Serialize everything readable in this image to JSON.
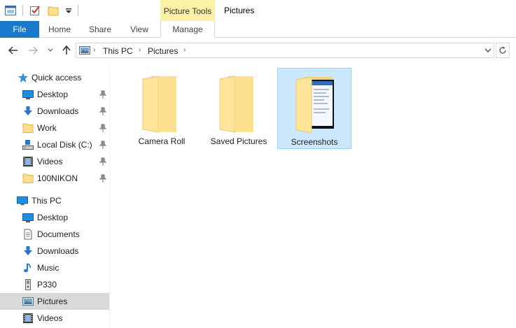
{
  "window": {
    "title": "Pictures"
  },
  "quick_access_toolbar": {
    "icons": [
      "properties-icon",
      "checkmark-icon",
      "new-folder-icon",
      "customize-dropdown-icon"
    ]
  },
  "ribbon": {
    "contextual_group": "Picture Tools",
    "tabs": [
      "File",
      "Home",
      "Share",
      "View",
      "Manage"
    ],
    "colors": {
      "file_tab": "#1979ca",
      "contextual": "#fbf2a8"
    }
  },
  "address_bar": {
    "crumbs": [
      "This PC",
      "Pictures"
    ],
    "icon": "pictures-library-icon"
  },
  "sidebar": {
    "quick_access": {
      "label": "Quick access",
      "items": [
        {
          "label": "Desktop",
          "icon": "desktop-icon",
          "pinned": true
        },
        {
          "label": "Downloads",
          "icon": "download-arrow-icon",
          "pinned": true
        },
        {
          "label": "Work",
          "icon": "folder-icon",
          "pinned": true
        },
        {
          "label": "Local Disk (C:)",
          "icon": "drive-icon",
          "pinned": true
        },
        {
          "label": "Videos",
          "icon": "film-icon",
          "pinned": true
        },
        {
          "label": "100NIKON",
          "icon": "folder-icon",
          "pinned": true
        }
      ]
    },
    "this_pc": {
      "label": "This PC",
      "items": [
        {
          "label": "Desktop",
          "icon": "desktop-icon"
        },
        {
          "label": "Documents",
          "icon": "document-icon"
        },
        {
          "label": "Downloads",
          "icon": "download-arrow-icon"
        },
        {
          "label": "Music",
          "icon": "music-note-icon"
        },
        {
          "label": "P330",
          "icon": "camera-device-icon"
        },
        {
          "label": "Pictures",
          "icon": "pictures-library-icon",
          "selected": true
        },
        {
          "label": "Videos",
          "icon": "film-icon"
        }
      ]
    }
  },
  "content": {
    "folders": [
      {
        "label": "Camera Roll",
        "selected": false
      },
      {
        "label": "Saved Pictures",
        "selected": false
      },
      {
        "label": "Screenshots",
        "selected": true
      }
    ]
  }
}
